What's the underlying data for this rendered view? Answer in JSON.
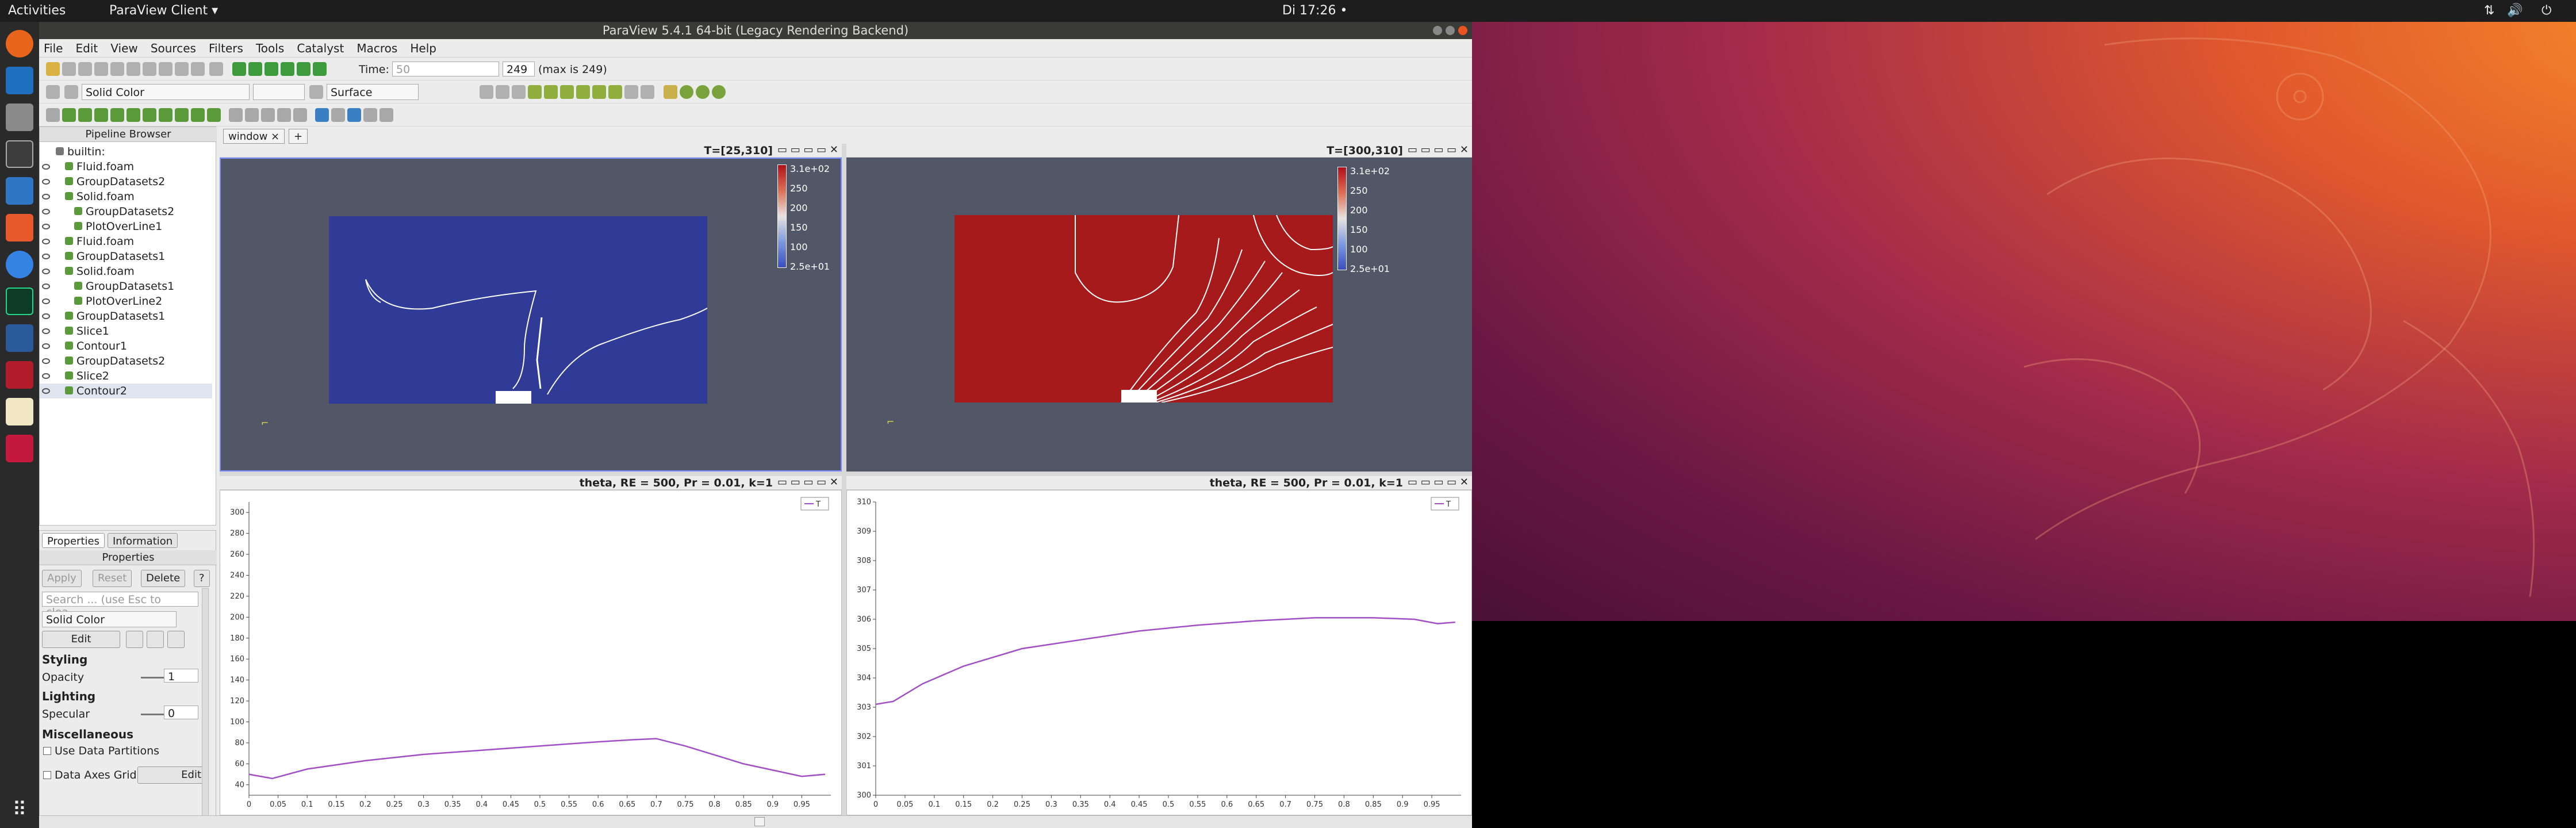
{
  "topbar": {
    "activities": "Activities",
    "app_menu": "ParaView Client ▾",
    "clock": "Di 17:26 •"
  },
  "window": {
    "title": "ParaView 5.4.1 64-bit (Legacy Rendering Backend)"
  },
  "menu": [
    "File",
    "Edit",
    "View",
    "Sources",
    "Filters",
    "Tools",
    "Catalyst",
    "Macros",
    "Help"
  ],
  "toolbar": {
    "time_label": "Time:",
    "time_value": "50",
    "step_value": "249",
    "max_label": "(max is 249)",
    "color_combo": "Solid Color",
    "repr_combo": "Surface"
  },
  "pipeline": {
    "header": "Pipeline Browser",
    "items": [
      {
        "label": "builtin:",
        "indent": 0
      },
      {
        "label": "Fluid.foam",
        "indent": 1
      },
      {
        "label": "GroupDatasets2",
        "indent": 1
      },
      {
        "label": "Solid.foam",
        "indent": 1
      },
      {
        "label": "GroupDatasets2",
        "indent": 2
      },
      {
        "label": "PlotOverLine1",
        "indent": 2
      },
      {
        "label": "Fluid.foam",
        "indent": 1
      },
      {
        "label": "GroupDatasets1",
        "indent": 1
      },
      {
        "label": "Solid.foam",
        "indent": 1
      },
      {
        "label": "GroupDatasets1",
        "indent": 2
      },
      {
        "label": "PlotOverLine2",
        "indent": 2
      },
      {
        "label": "GroupDatasets1",
        "indent": 1
      },
      {
        "label": "Slice1",
        "indent": 1
      },
      {
        "label": "Contour1",
        "indent": 1
      },
      {
        "label": "GroupDatasets2",
        "indent": 1
      },
      {
        "label": "Slice2",
        "indent": 1
      },
      {
        "label": "Contour2",
        "indent": 1
      }
    ]
  },
  "props": {
    "tab_properties": "Properties",
    "tab_information": "Information",
    "header": "Properties",
    "apply": "Apply",
    "reset": "Reset",
    "delete": "Delete",
    "help": "?",
    "search_placeholder": "Search ... (use Esc to clea...",
    "color_combo": "Solid Color",
    "edit": "Edit",
    "styling": "Styling",
    "opacity_label": "Opacity",
    "opacity_value": "1",
    "lighting": "Lighting",
    "specular_label": "Specular",
    "specular_value": "0",
    "misc": "Miscellaneous",
    "use_partitions": "Use Data Partitions",
    "data_axes_grid": "Data Axes Grid",
    "edit2": "Edit"
  },
  "view_tab": {
    "label": "window",
    "close": "×",
    "add": "+"
  },
  "views": {
    "left_top_title": "T=[25,310]",
    "right_top_title": "T=[300,310]",
    "left_bottom_title": "theta, RE = 500, Pr = 0.01, k=1",
    "right_bottom_title": "theta, RE = 500, Pr = 0.01, k=1"
  },
  "colorbars": {
    "left": [
      "3.1e+02",
      "250",
      "200",
      "150",
      "100",
      "2.5e+01"
    ],
    "right": [
      "3.1e+02",
      "250",
      "200",
      "150",
      "100",
      "2.5e+01"
    ]
  },
  "chart_data": [
    {
      "type": "line",
      "title": "",
      "legend": "T",
      "xlim": [
        0,
        1
      ],
      "ylim": [
        30,
        310
      ],
      "x_ticks": [
        "0",
        "0.05",
        "0.1",
        "0.15",
        "0.2",
        "0.25",
        "0.3",
        "0.35",
        "0.4",
        "0.45",
        "0.5",
        "0.55",
        "0.6",
        "0.65",
        "0.7",
        "0.75",
        "0.8",
        "0.85",
        "0.9",
        "0.95"
      ],
      "y_ticks": [
        "40",
        "60",
        "80",
        "100",
        "120",
        "140",
        "160",
        "180",
        "200",
        "220",
        "240",
        "260",
        "280",
        "300"
      ],
      "series": [
        {
          "name": "T",
          "color": "#a04fc4",
          "x": [
            0,
            0.04,
            0.1,
            0.2,
            0.3,
            0.4,
            0.5,
            0.6,
            0.66,
            0.7,
            0.75,
            0.85,
            0.95,
            0.99
          ],
          "y": [
            50,
            46,
            55,
            63,
            69,
            73,
            77,
            81,
            83,
            84,
            77,
            60,
            48,
            50
          ]
        }
      ]
    },
    {
      "type": "line",
      "title": "",
      "legend": "T",
      "xlim": [
        0,
        1
      ],
      "ylim": [
        300,
        310
      ],
      "x_ticks": [
        "0",
        "0.05",
        "0.1",
        "0.15",
        "0.2",
        "0.25",
        "0.3",
        "0.35",
        "0.4",
        "0.45",
        "0.5",
        "0.55",
        "0.6",
        "0.65",
        "0.7",
        "0.75",
        "0.8",
        "0.85",
        "0.9",
        "0.95"
      ],
      "y_ticks": [
        "300",
        "301",
        "302",
        "303",
        "304",
        "305",
        "306",
        "307",
        "308",
        "309",
        "310"
      ],
      "series": [
        {
          "name": "T",
          "color": "#a04fc4",
          "x": [
            0,
            0.03,
            0.08,
            0.15,
            0.25,
            0.35,
            0.45,
            0.55,
            0.65,
            0.75,
            0.85,
            0.92,
            0.96,
            0.99
          ],
          "y": [
            303.1,
            303.2,
            303.8,
            304.4,
            305.0,
            305.3,
            305.6,
            305.8,
            305.95,
            306.05,
            306.05,
            306.0,
            305.85,
            305.9
          ]
        }
      ]
    }
  ]
}
